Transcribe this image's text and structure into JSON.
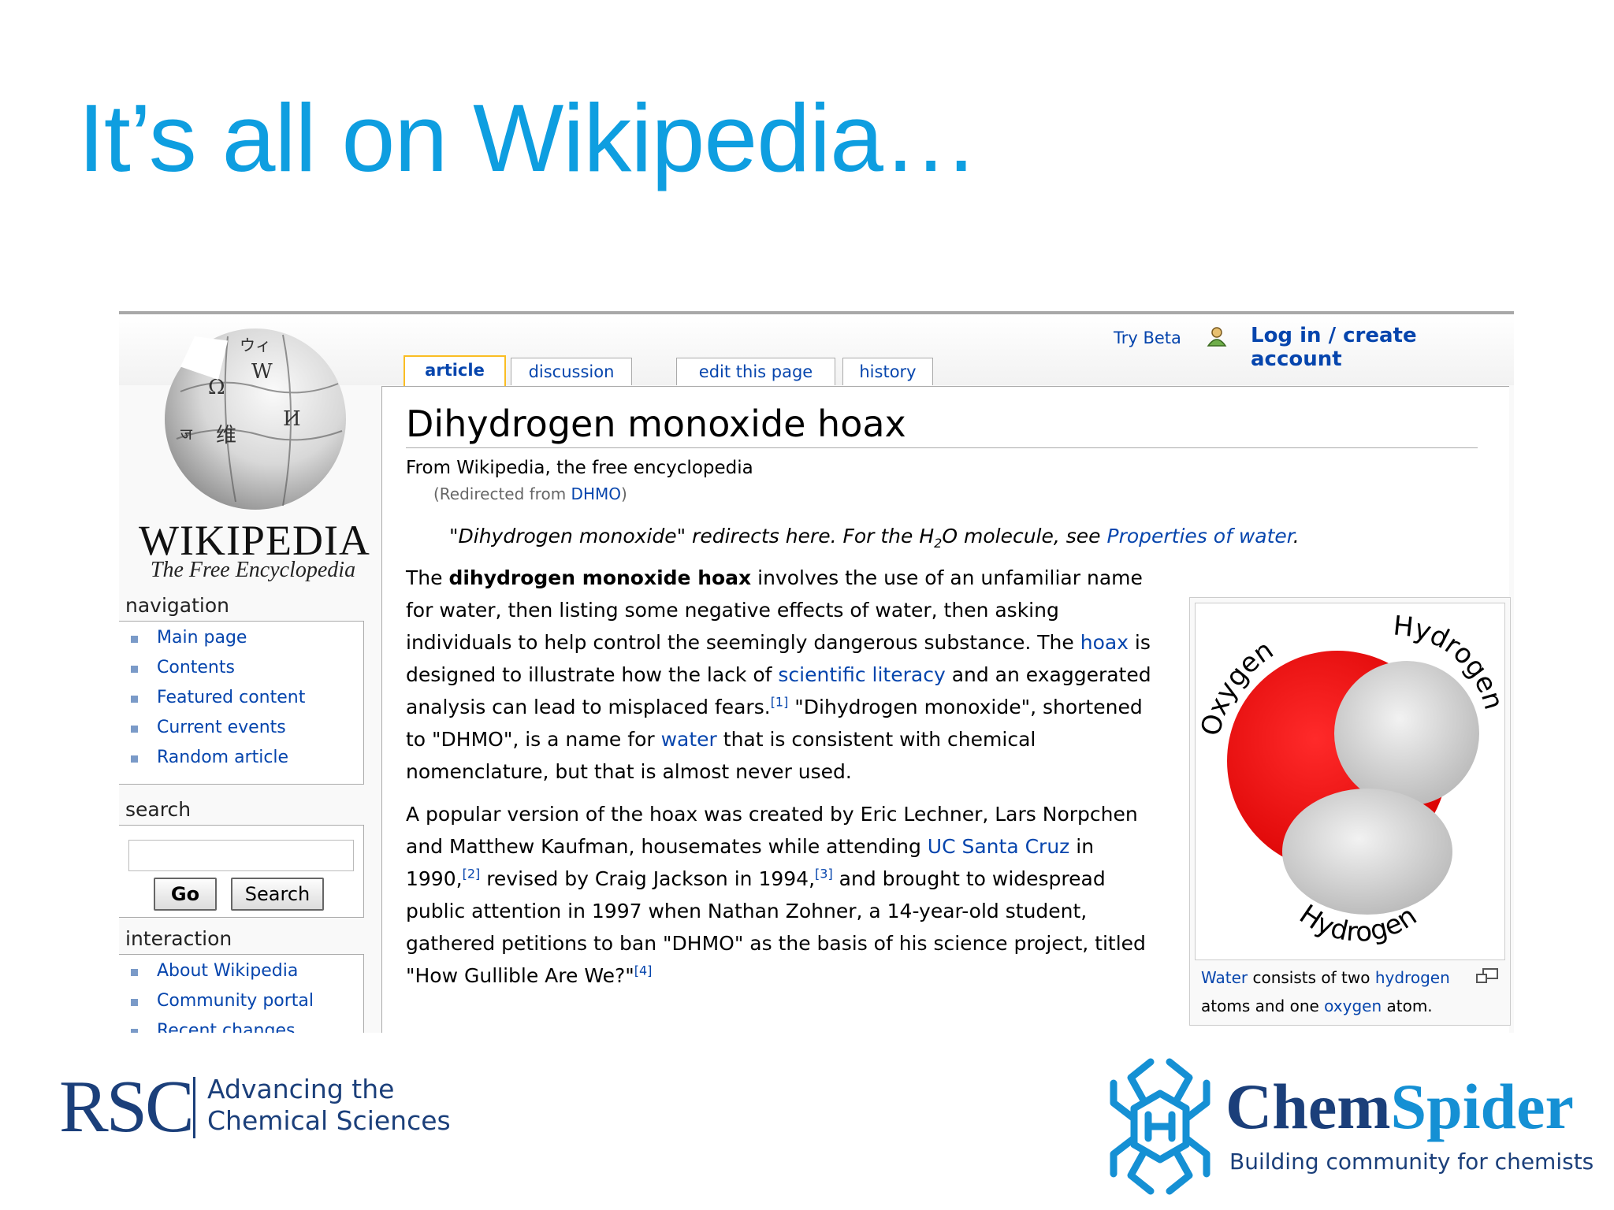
{
  "slide": {
    "title": "It’s all on Wikipedia…"
  },
  "wiki": {
    "logo": {
      "wordmark": "WIKIPEDIA",
      "tagline": "The Free Encyclopedia"
    },
    "top_links": {
      "try_beta": "Try Beta",
      "login": "Log in / create account"
    },
    "tabs": [
      {
        "label": "article"
      },
      {
        "label": "discussion"
      },
      {
        "label": "edit this page"
      },
      {
        "label": "history"
      }
    ],
    "sidebar": {
      "navigation_heading": "navigation",
      "navigation": [
        "Main page",
        "Contents",
        "Featured content",
        "Current events",
        "Random article"
      ],
      "search_heading": "search",
      "search_value": "",
      "go_label": "Go",
      "search_label": "Search",
      "interaction_heading": "interaction",
      "interaction": [
        "About Wikipedia",
        "Community portal",
        "Recent changes"
      ]
    },
    "article": {
      "title": "Dihydrogen monoxide hoax",
      "subtitle": "From Wikipedia, the free encyclopedia",
      "redirect_prefix": "(Redirected from ",
      "redirect_link": "DHMO",
      "redirect_suffix": ")",
      "hatnote_prefix": "\"Dihydrogen monoxide\" redirects here. For the H",
      "hatnote_sub": "2",
      "hatnote_mid": "O molecule, see ",
      "hatnote_link": "Properties of water",
      "hatnote_suffix": ".",
      "p1": {
        "t1": "The ",
        "bold": "dihydrogen monoxide hoax",
        "t2": " involves the use of an unfamiliar name for water, then listing some negative effects of water, then asking individuals to help control the seemingly dangerous substance. The ",
        "link1": "hoax",
        "t3": " is designed to illustrate how the lack of ",
        "link2": "scientific literacy",
        "t4": " and an exaggerated analysis can lead to misplaced fears.",
        "ref1": "[1]",
        "t5": " \"Dihydrogen monoxide\", shortened to \"DHMO\", is a name for ",
        "link3": "water",
        "t6": " that is consistent with chemical nomenclature, but that is almost never used."
      },
      "p2": {
        "t1": "A popular version of the hoax was created by Eric Lechner, Lars Norpchen and Matthew Kaufman, housemates while attending ",
        "link1": "UC Santa Cruz",
        "t2": " in 1990,",
        "ref2": "[2]",
        "t3": " revised by Craig Jackson in 1994,",
        "ref3": "[3]",
        "t4": " and brought to widespread public attention in 1997 when Nathan Zohner, a 14-year-old student, gathered petitions to ban \"DHMO\" as the basis of his science project, titled \"How Gullible Are We?\"",
        "ref4": "[4]"
      }
    },
    "thumb": {
      "labels": {
        "oxygen": "Oxygen",
        "hydrogen_top": "Hydrogen",
        "hydrogen_bottom": "Hydrogen"
      },
      "caption": {
        "link1": "Water",
        "t1": " consists of two ",
        "link2": "hydrogen",
        "t2": " atoms and one ",
        "link3": "oxygen",
        "t3": " atom."
      },
      "colors": {
        "oxygen": "#ee1111",
        "hydrogen": "#dcdcdc"
      }
    }
  },
  "footer": {
    "rsc": {
      "word": "RSC",
      "line1": "Advancing the",
      "line2": "Chemical Sciences"
    },
    "chemspider": {
      "chem": "Chem",
      "spider": "Spider",
      "tagline": "Building community for chemists"
    }
  },
  "colors": {
    "title": "#0e9ee0",
    "link": "#0645ad",
    "rsc": "#1b3f7a",
    "chemspider_light": "#1590d4"
  }
}
